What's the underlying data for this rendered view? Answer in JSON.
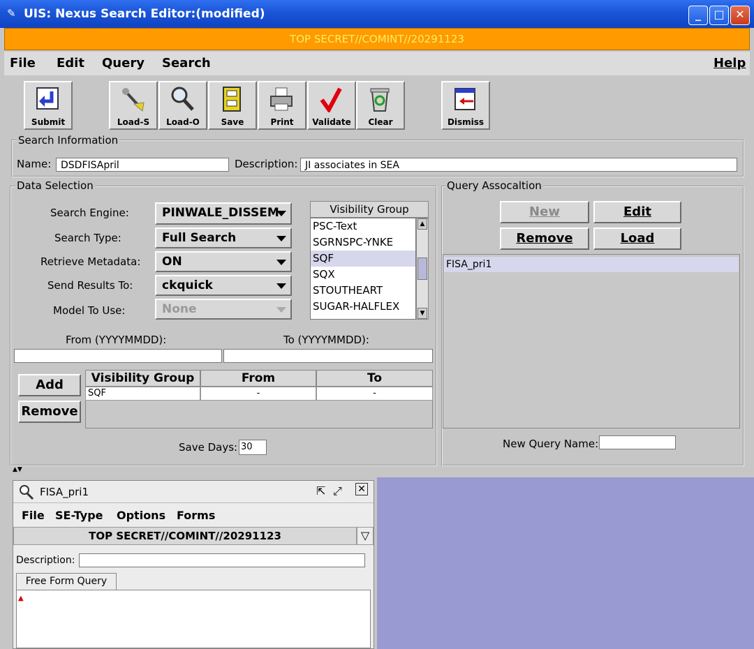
{
  "window": {
    "title": "UIS: Nexus Search Editor:(modified)",
    "classification": "TOP SECRET//COMINT//20291123",
    "controls": {
      "minimize": "_",
      "maximize": "□",
      "close": "✕"
    }
  },
  "menu": {
    "file": "File",
    "edit": "Edit",
    "query": "Query",
    "search": "Search",
    "help": "Help"
  },
  "toolbar": [
    {
      "label": "Submit",
      "icon": "submit-arrow-icon"
    },
    {
      "label": "Load-S",
      "icon": "load-s-icon"
    },
    {
      "label": "Load-O",
      "icon": "magnifier-icon"
    },
    {
      "label": "Save",
      "icon": "cabinet-icon"
    },
    {
      "label": "Print",
      "icon": "printer-icon"
    },
    {
      "label": "Validate",
      "icon": "checkmark-icon"
    },
    {
      "label": "Clear",
      "icon": "recycle-bin-icon"
    },
    {
      "label": "Dismiss",
      "icon": "dismiss-icon"
    }
  ],
  "search_info": {
    "title": "Search Information",
    "name_label": "Name:",
    "name_value": "DSDFISApril",
    "desc_label": "Description:",
    "desc_value": "JI associates in SEA"
  },
  "data_selection": {
    "title": "Data Selection",
    "engine_label": "Search Engine:",
    "engine_value": "PINWALE_DISSEM",
    "type_label": "Search Type:",
    "type_value": "Full Search",
    "metadata_label": "Retrieve Metadata:",
    "metadata_value": "ON",
    "results_label": "Send Results To:",
    "results_value": "ckquick",
    "model_label": "Model To Use:",
    "model_value": "None",
    "vis_group_title": "Visibility Group",
    "vis_groups": [
      "PSC-Text",
      "SGRNSPC-YNKE",
      "SQF",
      "SQX",
      "STOUTHEART",
      "SUGAR-HALFLEX"
    ],
    "from_label": "From (YYYYMMDD):",
    "to_label": "To (YYYYMMDD):",
    "add_label": "Add",
    "remove_label": "Remove",
    "table_headers": [
      "Visibility Group",
      "From",
      "To"
    ],
    "table_rows": [
      [
        "SQF",
        "-",
        "-"
      ]
    ],
    "save_days_label": "Save Days:",
    "save_days_value": "30"
  },
  "query_assoc": {
    "title": "Query Assocaltion",
    "new_label": "New",
    "edit_label": "Edit",
    "remove_label": "Remove",
    "load_label": "Load",
    "items": [
      "FISA_pri1"
    ],
    "new_query_label": "New Query Name:"
  },
  "inner_window": {
    "title": "FISA_pri1",
    "menu": {
      "file": "File",
      "setype": "SE-Type",
      "options": "Options",
      "forms": "Forms"
    },
    "classification": "TOP SECRET//COMINT//20291123",
    "desc_label": "Description:",
    "tab_label": "Free Form Query"
  }
}
